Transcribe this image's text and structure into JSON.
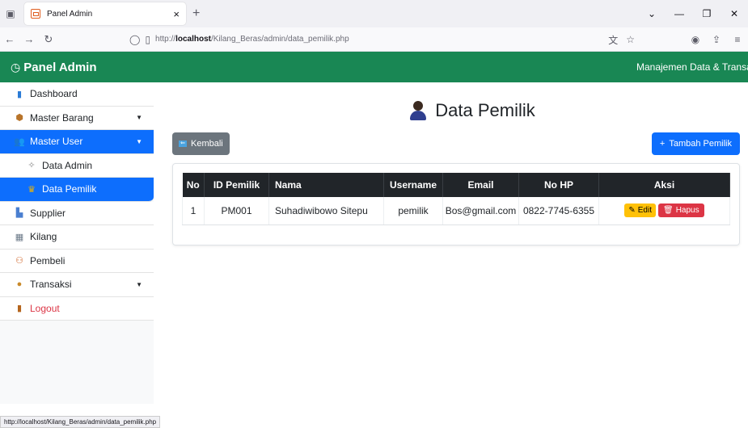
{
  "browser": {
    "tab_title": "Panel Admin",
    "url_prefix": "http://",
    "url_host": "localhost",
    "url_path": "/Kilang_Beras/admin/data_pemilik.php",
    "status_url": "http://localhost/Kilang_Beras/admin/data_pemilik.php"
  },
  "header": {
    "brand": "Panel Admin",
    "right_text": "Manajemen Data & Transaksi"
  },
  "sidebar": {
    "items": [
      {
        "label": "Dashboard"
      },
      {
        "label": "Master Barang"
      },
      {
        "label": "Master User"
      },
      {
        "label": "Data Admin"
      },
      {
        "label": "Data Pemilik"
      },
      {
        "label": "Supplier"
      },
      {
        "label": "Kilang"
      },
      {
        "label": "Pembeli"
      },
      {
        "label": "Transaksi"
      },
      {
        "label": "Logout"
      }
    ]
  },
  "main": {
    "title": "Data Pemilik",
    "back_label": "Kembali",
    "add_label": "Tambah Pemilik",
    "table": {
      "headers": [
        "No",
        "ID Pemilik",
        "Nama",
        "Username",
        "Email",
        "No HP",
        "Aksi"
      ],
      "rows": [
        {
          "no": "1",
          "id": "PM001",
          "nama": "Suhadiwibowo Sitepu",
          "username": "pemilik",
          "email": "Bos@gmail.com",
          "hp": "0822-7745-6355"
        }
      ],
      "edit_label": "Edit",
      "delete_label": "Hapus"
    }
  },
  "colors": {
    "header_bg": "#198754",
    "primary": "#0d6efd",
    "warning": "#ffc107",
    "danger": "#dc3545",
    "secondary": "#6c757d"
  }
}
